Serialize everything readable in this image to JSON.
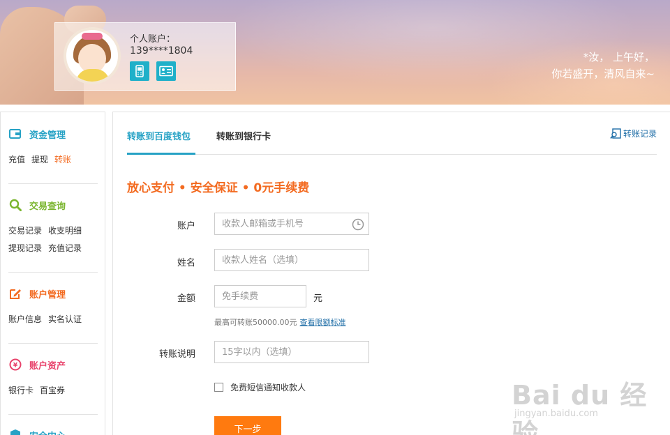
{
  "banner": {
    "account_label": "个人账户：",
    "phone": "139****1804",
    "greeting_line1": "*汝， 上午好，",
    "greeting_line2": "你若盛开，清风自来~"
  },
  "sidebar": {
    "sections": [
      {
        "title": "资金管理",
        "color": "#26a2c5",
        "icon": "wallet-icon",
        "links": [
          "充值",
          "提现",
          "转账"
        ],
        "active": "转账"
      },
      {
        "title": "交易查询",
        "color": "#7ab52e",
        "icon": "search-icon",
        "links": [
          "交易记录",
          "收支明细",
          "提现记录",
          "充值记录"
        ]
      },
      {
        "title": "账户管理",
        "color": "#f36b21",
        "icon": "edit-icon",
        "links": [
          "账户信息",
          "实名认证"
        ]
      },
      {
        "title": "账户资产",
        "color": "#e8416a",
        "icon": "yen-icon",
        "links": [
          "银行卡",
          "百宝券"
        ]
      },
      {
        "title": "安全中心",
        "color": "#26a2c5",
        "icon": "shield-icon",
        "links": []
      }
    ]
  },
  "main": {
    "tabs": [
      "转账到百度钱包",
      "转账到银行卡"
    ],
    "records_link": "转账记录",
    "slogan": "放心支付 • 安全保证 • 0元手续费",
    "form": {
      "account_label": "账户",
      "account_placeholder": "收款人邮箱或手机号",
      "name_label": "姓名",
      "name_placeholder": "收款人姓名（选填）",
      "amount_label": "金额",
      "amount_placeholder": "免手续费",
      "amount_unit": "元",
      "hint": "最高可转账50000.00元",
      "hint_link": "查看限额标准",
      "note_label": "转账说明",
      "note_placeholder": "15字以内（选填）",
      "sms_label": "免费短信通知收款人",
      "submit": "下一步"
    }
  },
  "watermark": {
    "brand": "Bai du 经验",
    "url": "jingyan.baidu.com"
  },
  "colors": {
    "accent_blue": "#26a2c5",
    "orange": "#f36b21",
    "button_orange": "#ff7a0f"
  }
}
